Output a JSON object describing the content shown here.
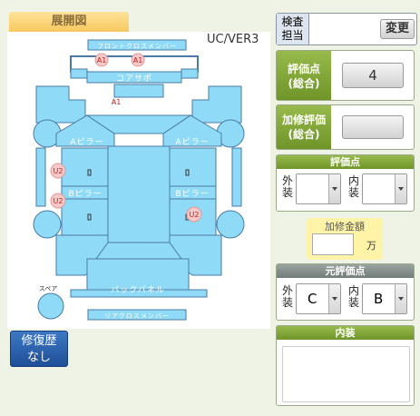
{
  "map": {
    "tab_label": "展開図",
    "version": "UC/VER3",
    "parts": {
      "front_cross_member": "フロントクロスメンバー",
      "core_support": "コアサポ",
      "a_pillar_left": "Aピラー",
      "a_pillar_right": "Aピラー",
      "b_pillar_left": "Bピラー",
      "b_pillar_right": "Bピラー",
      "spare": "スペア",
      "back_panel": "バックパネル",
      "rear_cross_member": "リアクロスメンバー"
    },
    "marks": [
      {
        "part": "front_cross_member_left",
        "code": "A1"
      },
      {
        "part": "front_cross_member_right",
        "code": "A1"
      },
      {
        "part": "core_support_area",
        "code": "A1"
      },
      {
        "part": "left_side_upper",
        "code": "U2"
      },
      {
        "part": "left_side_lower",
        "code": "U2"
      },
      {
        "part": "right_side_lower",
        "code": "U2"
      }
    ]
  },
  "repair": {
    "line1": "修復歴",
    "line2": "なし"
  },
  "inspector": {
    "line1": "検査",
    "line2": "担当",
    "change_label": "変更"
  },
  "score": {
    "line1": "評価点",
    "line2": "(総合)",
    "value": "4"
  },
  "repair_score": {
    "line1": "加修評価",
    "line2": "(総合)",
    "value": ""
  },
  "rating": {
    "header": "評価点",
    "exterior": {
      "line1": "外",
      "line2": "装",
      "value": ""
    },
    "interior": {
      "line1": "内",
      "line2": "装",
      "value": ""
    }
  },
  "repair_amount": {
    "label": "加修金額",
    "value": "",
    "unit": "万"
  },
  "original_rating": {
    "header": "元評価点",
    "exterior": {
      "line1": "外",
      "line2": "装",
      "value": "C"
    },
    "interior": {
      "line1": "内",
      "line2": "装",
      "value": "B"
    }
  },
  "interior_notes": {
    "header": "内装",
    "value": ""
  }
}
